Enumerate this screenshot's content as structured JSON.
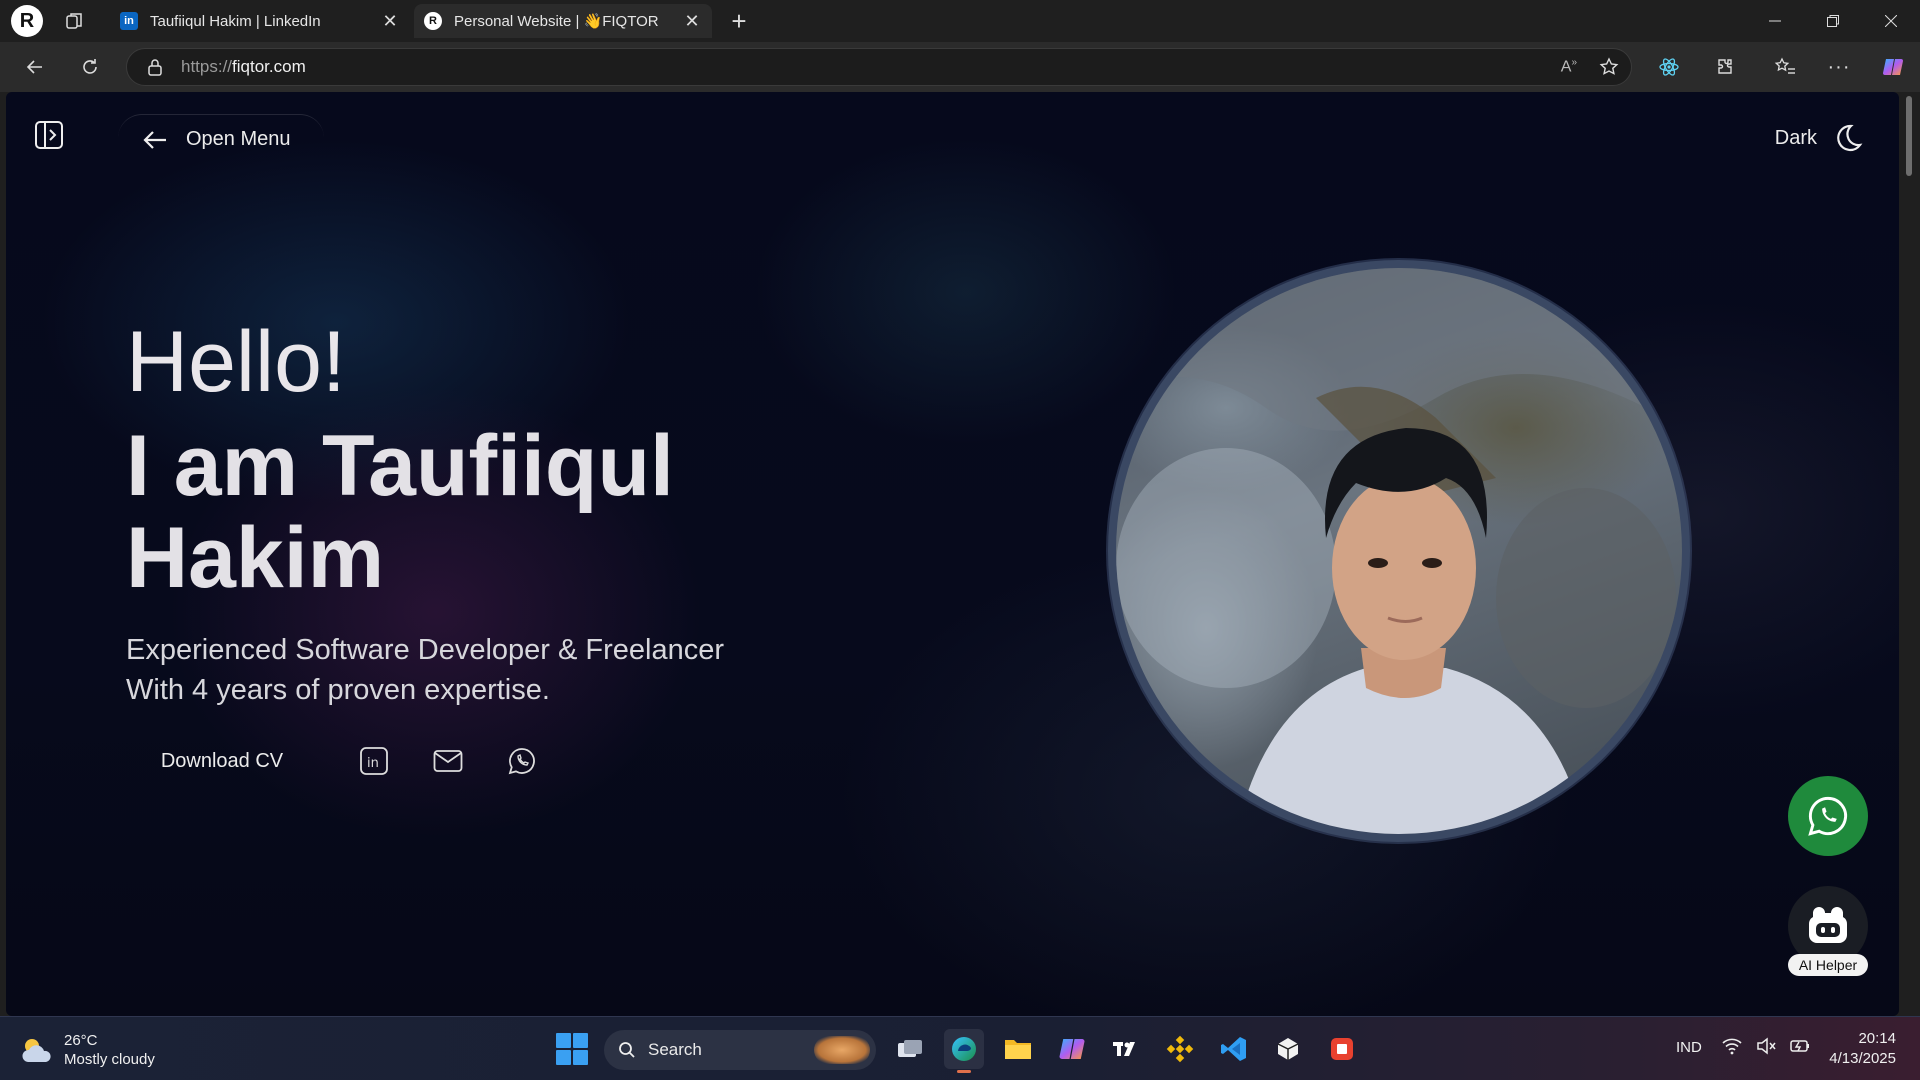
{
  "browser": {
    "tabs": [
      {
        "favicon": "in",
        "title": "Taufiiqul Hakim | LinkedIn"
      },
      {
        "favicon": "R",
        "title": "Personal Website | 👋FIQTOR"
      }
    ],
    "url_protocol": "https://",
    "url_host": "fiqtor.com",
    "profile_initial": "R"
  },
  "page": {
    "menu_label": "Open Menu",
    "theme_label": "Dark",
    "greeting": "Hello!",
    "name_line": "I am Taufiiqul Hakim",
    "subtitle_line1": "Experienced Software Developer & Freelancer",
    "subtitle_line2": "With 4 years of proven expertise.",
    "download_cv": "Download CV",
    "ai_helper_label": "AI Helper"
  },
  "taskbar": {
    "temperature": "26°C",
    "weather": "Mostly cloudy",
    "search_label": "Search",
    "language": "IND",
    "time": "20:14",
    "date": "4/13/2025"
  },
  "colors": {
    "page_background": "#070a1c",
    "whatsapp_green": "#1f8a3c",
    "linkedin_blue": "#0a66c2"
  }
}
